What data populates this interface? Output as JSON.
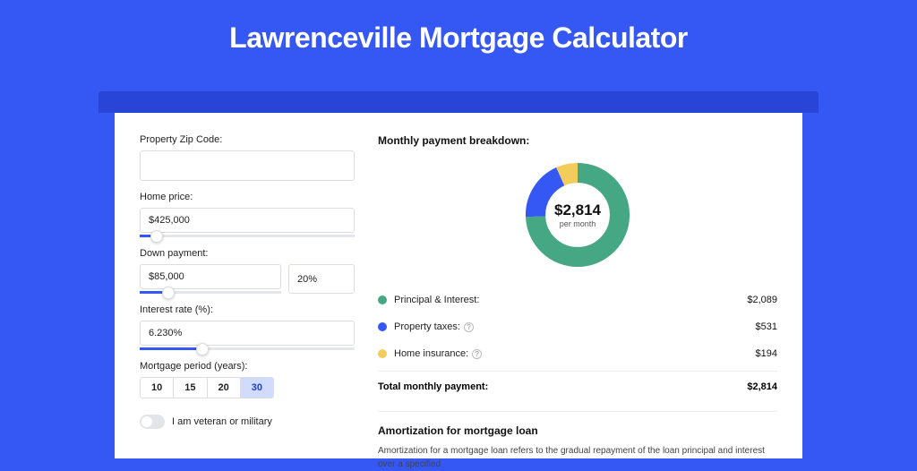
{
  "title": "Lawrenceville Mortgage Calculator",
  "left": {
    "zip_label": "Property Zip Code:",
    "zip_value": "",
    "home_price_label": "Home price:",
    "home_price_value": "$425,000",
    "home_price_slider_pct": 8,
    "down_label": "Down payment:",
    "down_value": "$85,000",
    "down_pct": "20%",
    "down_slider_pct": 20,
    "rate_label": "Interest rate (%):",
    "rate_value": "6.230%",
    "rate_slider_pct": 29,
    "period_label": "Mortgage period (years):",
    "periods": [
      "10",
      "15",
      "20",
      "30"
    ],
    "period_active_index": 3,
    "veteran_label": "I am veteran or military"
  },
  "right": {
    "breakdown_title": "Monthly payment breakdown:",
    "donut_total": "$2,814",
    "donut_sub": "per month",
    "items": [
      {
        "label": "Principal & Interest:",
        "value": "$2,089",
        "color": "#45a783",
        "info": false
      },
      {
        "label": "Property taxes:",
        "value": "$531",
        "color": "#3557f4",
        "info": true
      },
      {
        "label": "Home insurance:",
        "value": "$194",
        "color": "#f2cd5c",
        "info": true
      }
    ],
    "total_label": "Total monthly payment:",
    "total_value": "$2,814",
    "amort_title": "Amortization for mortgage loan",
    "amort_text": "Amortization for a mortgage loan refers to the gradual repayment of the loan principal and interest over a specified"
  },
  "chart_data": {
    "type": "pie",
    "title": "Monthly payment breakdown",
    "categories": [
      "Principal & Interest",
      "Property taxes",
      "Home insurance"
    ],
    "values": [
      2089,
      531,
      194
    ],
    "colors": [
      "#45a783",
      "#3557f4",
      "#f2cd5c"
    ],
    "total": 2814,
    "donut": true
  }
}
